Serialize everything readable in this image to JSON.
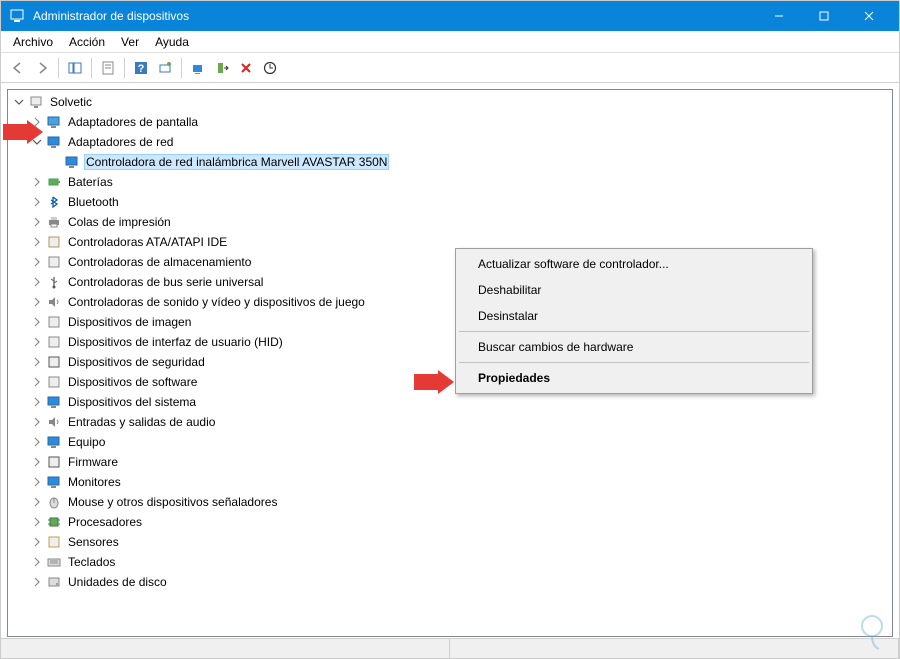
{
  "window": {
    "title": "Administrador de dispositivos"
  },
  "menubar": {
    "items": [
      "Archivo",
      "Acción",
      "Ver",
      "Ayuda"
    ]
  },
  "tree": {
    "root": "Solvetic",
    "nodes": [
      {
        "label": "Adaptadores de pantalla",
        "icon": "display"
      },
      {
        "label": "Adaptadores de red",
        "icon": "network",
        "expanded": true,
        "children": [
          {
            "label": "Controladora de red inalámbrica Marvell AVASTAR 350N",
            "icon": "network",
            "selected": true
          }
        ]
      },
      {
        "label": "Baterías",
        "icon": "battery"
      },
      {
        "label": "Bluetooth",
        "icon": "bluetooth"
      },
      {
        "label": "Colas de impresión",
        "icon": "printer"
      },
      {
        "label": "Controladoras ATA/ATAPI IDE",
        "icon": "ide"
      },
      {
        "label": "Controladoras de almacenamiento",
        "icon": "storage"
      },
      {
        "label": "Controladoras de bus serie universal",
        "icon": "usb"
      },
      {
        "label": "Controladoras de sonido y vídeo y dispositivos de juego",
        "icon": "sound"
      },
      {
        "label": "Dispositivos de imagen",
        "icon": "imaging"
      },
      {
        "label": "Dispositivos de interfaz de usuario (HID)",
        "icon": "hid"
      },
      {
        "label": "Dispositivos de seguridad",
        "icon": "security"
      },
      {
        "label": "Dispositivos de software",
        "icon": "software"
      },
      {
        "label": "Dispositivos del sistema",
        "icon": "system"
      },
      {
        "label": "Entradas y salidas de audio",
        "icon": "audio"
      },
      {
        "label": "Equipo",
        "icon": "computer"
      },
      {
        "label": "Firmware",
        "icon": "firmware"
      },
      {
        "label": "Monitores",
        "icon": "monitor"
      },
      {
        "label": "Mouse y otros dispositivos señaladores",
        "icon": "mouse"
      },
      {
        "label": "Procesadores",
        "icon": "cpu"
      },
      {
        "label": "Sensores",
        "icon": "sensor"
      },
      {
        "label": "Teclados",
        "icon": "keyboard"
      },
      {
        "label": "Unidades de disco",
        "icon": "disk"
      }
    ]
  },
  "context_menu": {
    "items": [
      {
        "label": "Actualizar software de controlador...",
        "type": "item"
      },
      {
        "label": "Deshabilitar",
        "type": "item"
      },
      {
        "label": "Desinstalar",
        "type": "item"
      },
      {
        "type": "sep"
      },
      {
        "label": "Buscar cambios de hardware",
        "type": "item"
      },
      {
        "type": "sep"
      },
      {
        "label": "Propiedades",
        "type": "item",
        "bold": true
      }
    ]
  },
  "icons": {
    "display": "#4aa3df",
    "network": "#2e8bd8",
    "battery": "#6aa84f",
    "bluetooth": "#0a5ab3",
    "printer": "#888",
    "ide": "#b39455",
    "storage": "#888",
    "usb": "#555",
    "sound": "#888",
    "imaging": "#888",
    "hid": "#888",
    "security": "#555",
    "software": "#888",
    "system": "#2e8bd8",
    "audio": "#888",
    "computer": "#2e8bd8",
    "firmware": "#555",
    "monitor": "#2e8bd8",
    "mouse": "#888",
    "cpu": "#6aa84f",
    "sensor": "#c3a04a",
    "keyboard": "#888",
    "disk": "#888",
    "pc": "#888"
  }
}
